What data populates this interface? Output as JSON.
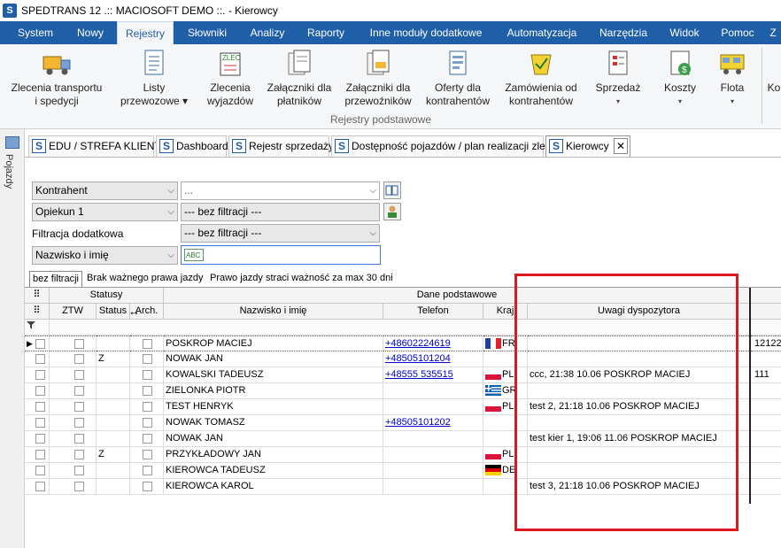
{
  "window": {
    "title": "SPEDTRANS 12 .:: MACIOSOFT DEMO ::. - Kierowcy"
  },
  "menu": [
    {
      "label": "System"
    },
    {
      "label": "Nowy"
    },
    {
      "label": "Rejestry"
    },
    {
      "label": "Słowniki"
    },
    {
      "label": "Analizy"
    },
    {
      "label": "Raporty"
    },
    {
      "label": "Inne moduły dodatkowe"
    },
    {
      "label": "Automatyzacja"
    },
    {
      "label": "Narzędzia"
    },
    {
      "label": "Widok"
    },
    {
      "label": "Pomoc"
    },
    {
      "label": "Z"
    }
  ],
  "ribbon": {
    "buttons": [
      {
        "line1": "Zlecenia transportu",
        "line2": "i spedycji",
        "icon": "truck-icon"
      },
      {
        "line1": "Listy",
        "line2": "przewozowe ▾",
        "icon": "list-document-icon"
      },
      {
        "line1": "Zlecenia",
        "line2": "wyjazdów",
        "icon": "zlec-document-icon"
      },
      {
        "line1": "Załączniki dla",
        "line2": "płatników",
        "icon": "attachments-icon"
      },
      {
        "line1": "Załączniki dla",
        "line2": "przewoźników",
        "icon": "attachments-carrier-icon"
      },
      {
        "line1": "Oferty dla",
        "line2": "kontrahentów",
        "icon": "offers-icon"
      },
      {
        "line1": "Zamówienia od",
        "line2": "kontrahentów",
        "icon": "orders-icon"
      },
      {
        "line1": "Sprzedaż",
        "line2": "▾",
        "icon": "sales-icon"
      },
      {
        "line1": "Koszty",
        "line2": "▾",
        "icon": "costs-icon"
      },
      {
        "line1": "Flota",
        "line2": "▾",
        "icon": "fleet-icon"
      },
      {
        "line1": "Ko",
        "line2": "",
        "icon": "more-icon"
      }
    ],
    "group_label": "Rejestry podstawowe"
  },
  "side_panel": {
    "label": "Pojazdy"
  },
  "doc_tabs": [
    {
      "label": "EDU / STREFA KLIENTA"
    },
    {
      "label": "Dashboard"
    },
    {
      "label": "Rejestr sprzedaży"
    },
    {
      "label": "Dostępność pojazdów / plan realizacji zleceń"
    },
    {
      "label": "Kierowcy",
      "active": true
    }
  ],
  "filters": {
    "kontrahent_label": "Kontrahent",
    "kontrahent_value": "...",
    "opiekun_label": "Opiekun 1",
    "opiekun_value": "--- bez filtracji ---",
    "dodatkowa_label": "Filtracja dodatkowa",
    "dodatkowa_value": "--- bez filtracji ---",
    "search_field_label": "Nazwisko i imię",
    "search_value": ""
  },
  "filter_tabs": [
    {
      "label": "bez filtracji",
      "active": true
    },
    {
      "label": "Brak ważnego prawa jazdy"
    },
    {
      "label": "Prawo jazdy straci ważność za max 30 dni"
    }
  ],
  "grid": {
    "band_statusy": "Statusy",
    "band_dane": "Dane podstawowe",
    "columns": {
      "ztw": "ZTW",
      "status": "Status",
      "arch": "Arch.",
      "name": "Nazwisko i imię",
      "phone": "Telefon",
      "country": "Kraj",
      "notes": "Uwagi dyspozytora"
    },
    "rows": [
      {
        "status": "",
        "name": "POSKROP MACIEJ",
        "phone": "+48602224619",
        "country": "FR",
        "notes": "",
        "extra": "12122"
      },
      {
        "status": "Z",
        "name": "NOWAK JAN",
        "phone": "+48505101204",
        "country": "",
        "notes": "",
        "extra": ""
      },
      {
        "status": "",
        "name": "KOWALSKI TADEUSZ",
        "phone": "+48555 535515",
        "country": "PL",
        "notes": "ccc, 21:38 10.06 POSKROP MACIEJ",
        "extra": "111"
      },
      {
        "status": "",
        "name": "ZIELONKA PIOTR",
        "phone": "",
        "country": "GR",
        "notes": "",
        "extra": ""
      },
      {
        "status": "",
        "name": "TEST HENRYK",
        "phone": "",
        "country": "PL",
        "notes": "test 2, 21:18 10.06 POSKROP MACIEJ",
        "extra": ""
      },
      {
        "status": "",
        "name": "NOWAK TOMASZ",
        "phone": "+48505101202",
        "country": "",
        "notes": "",
        "extra": ""
      },
      {
        "status": "",
        "name": "NOWAK JAN",
        "phone": "",
        "country": "",
        "notes": "test kier 1, 19:06 11.06 POSKROP MACIEJ",
        "extra": ""
      },
      {
        "status": "Z",
        "name": "PRZYKŁADOWY JAN",
        "phone": "",
        "country": "PL",
        "notes": "",
        "extra": ""
      },
      {
        "status": "",
        "name": "KIEROWCA TADEUSZ",
        "phone": "",
        "country": "DE",
        "notes": "",
        "extra": ""
      },
      {
        "status": "",
        "name": "KIEROWCA KAROL",
        "phone": "",
        "country": "",
        "notes": "test 3, 21:18 10.06 POSKROP MACIEJ",
        "extra": ""
      }
    ]
  },
  "colors": {
    "menubar": "#1f5fa8",
    "highlight_box": "#e0181e"
  }
}
